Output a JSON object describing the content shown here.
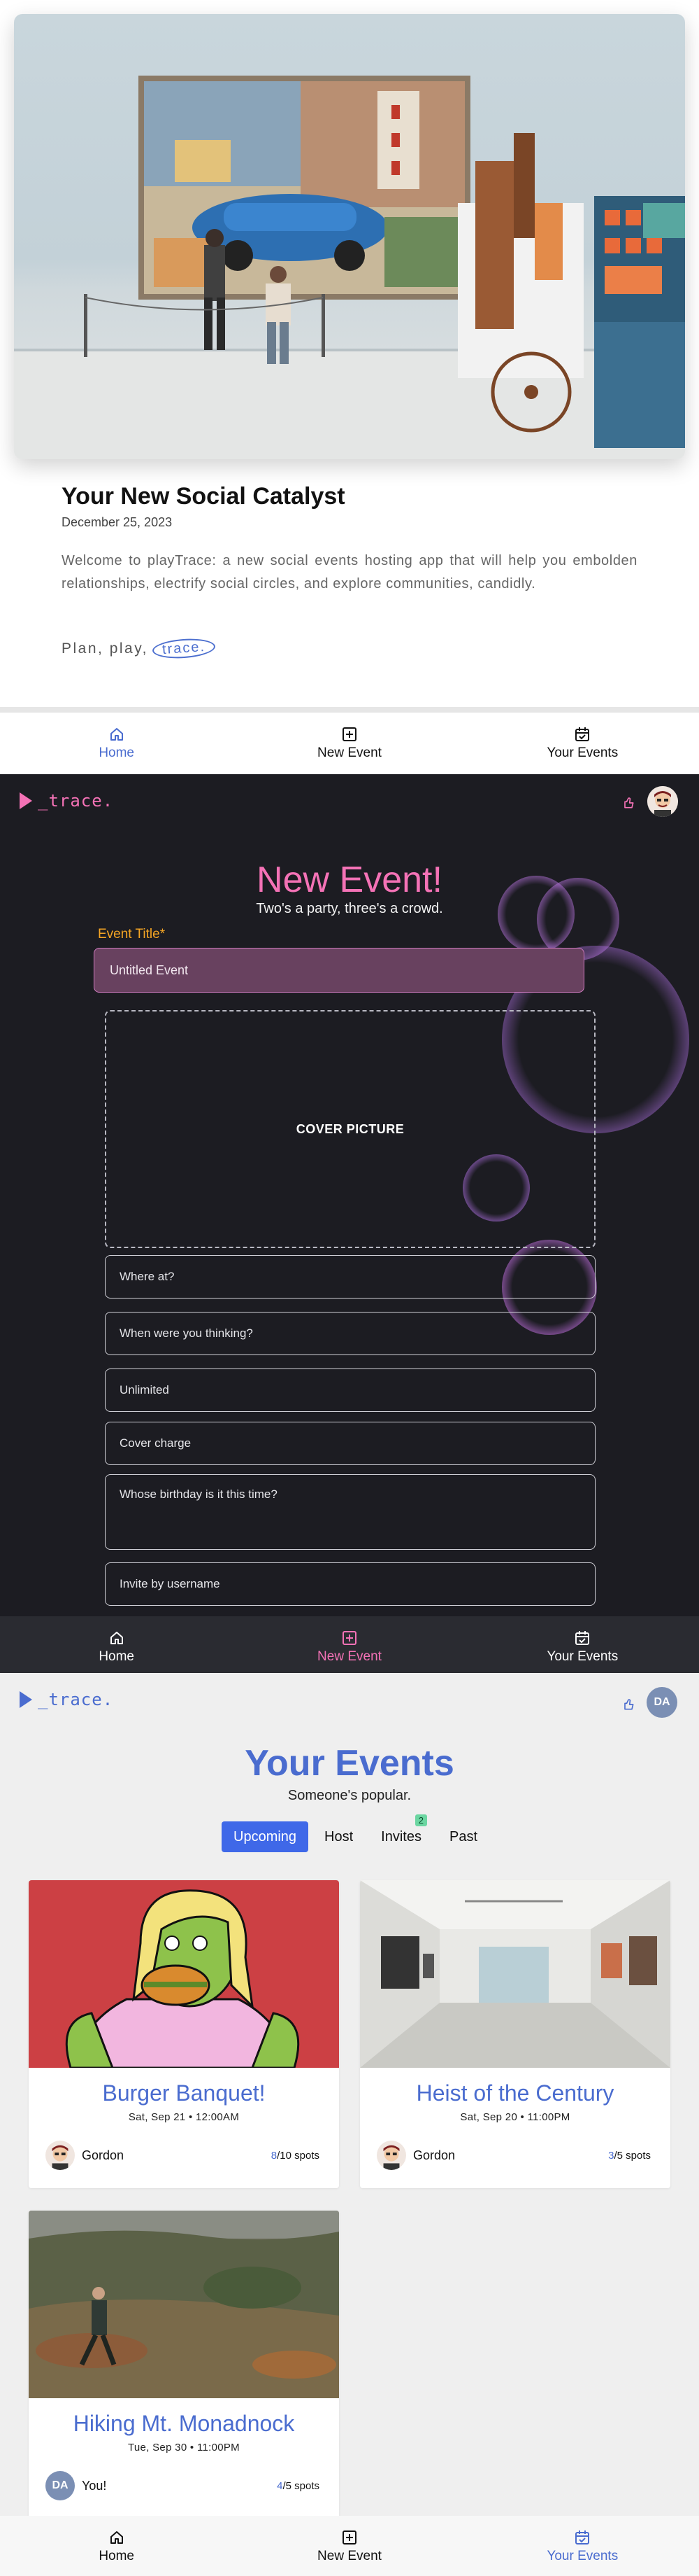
{
  "home": {
    "article": {
      "title": "Your New Social Catalyst",
      "date": "December 25, 2023",
      "body": "Welcome to playTrace: a new social events hosting app that will help you embolden relationships, electrify social circles, and explore communities, candidly.",
      "tagline": "Plan, play,",
      "tagline_brand": "trace."
    },
    "nav": [
      {
        "label": "Home",
        "icon": "home-icon"
      },
      {
        "label": "New Event",
        "icon": "plus-square-icon"
      },
      {
        "label": "Your Events",
        "icon": "calendar-check-icon"
      }
    ],
    "active_tab": "Home"
  },
  "new_event": {
    "logo": "_trace.",
    "heading": "New Event!",
    "subheading": "Two's a party, three's a crowd.",
    "title_label": "Event Title*",
    "title_value": "Untitled Event",
    "cover_label": "COVER PICTURE",
    "placeholders": {
      "location": "Where at?",
      "time": "When were you thinking?",
      "capacity": "Unlimited",
      "cover_charge": "Cover charge",
      "description": "Whose birthday is it this time?",
      "invite": "Invite by username"
    },
    "nav": [
      {
        "label": "Home",
        "icon": "home-icon"
      },
      {
        "label": "New Event",
        "icon": "plus-square-icon"
      },
      {
        "label": "Your Events",
        "icon": "calendar-check-icon"
      }
    ],
    "active_tab": "New Event",
    "colors": {
      "accent": "#f472b6",
      "label": "#f5a524",
      "background": "#1c1c22"
    }
  },
  "your_events": {
    "logo": "_trace.",
    "user_initials": "DA",
    "heading": "Your Events",
    "subheading": "Someone's popular.",
    "tabs": [
      {
        "label": "Upcoming",
        "active": true
      },
      {
        "label": "Host",
        "active": false
      },
      {
        "label": "Invites",
        "active": false,
        "badge": "2"
      },
      {
        "label": "Past",
        "active": false
      }
    ],
    "events": [
      {
        "title": "Burger Banquet!",
        "date": "Sat, Sep 21 • 12:00AM",
        "host": "Gordon",
        "spots_taken": "8",
        "spots_total": "/10 spots",
        "image": "cartoon-burger-eater"
      },
      {
        "title": "Heist of the Century",
        "date": "Sat, Sep 20 • 11:00PM",
        "host": "Gordon",
        "spots_taken": "3",
        "spots_total": "/5 spots",
        "image": "art-gallery-hall"
      },
      {
        "title": "Hiking Mt. Monadnock",
        "date": "Tue, Sep 30 • 11:00PM",
        "host": "You!",
        "spots_taken": "4",
        "spots_total": "/5 spots",
        "image": "hiker-on-hillside"
      }
    ],
    "nav": [
      {
        "label": "Home",
        "icon": "home-icon"
      },
      {
        "label": "New Event",
        "icon": "plus-square-icon"
      },
      {
        "label": "Your Events",
        "icon": "calendar-check-icon"
      }
    ],
    "active_tab": "Your Events",
    "colors": {
      "accent": "#4a6ccf",
      "tab_active": "#3f68e8",
      "badge": "#6bd6a1"
    }
  }
}
